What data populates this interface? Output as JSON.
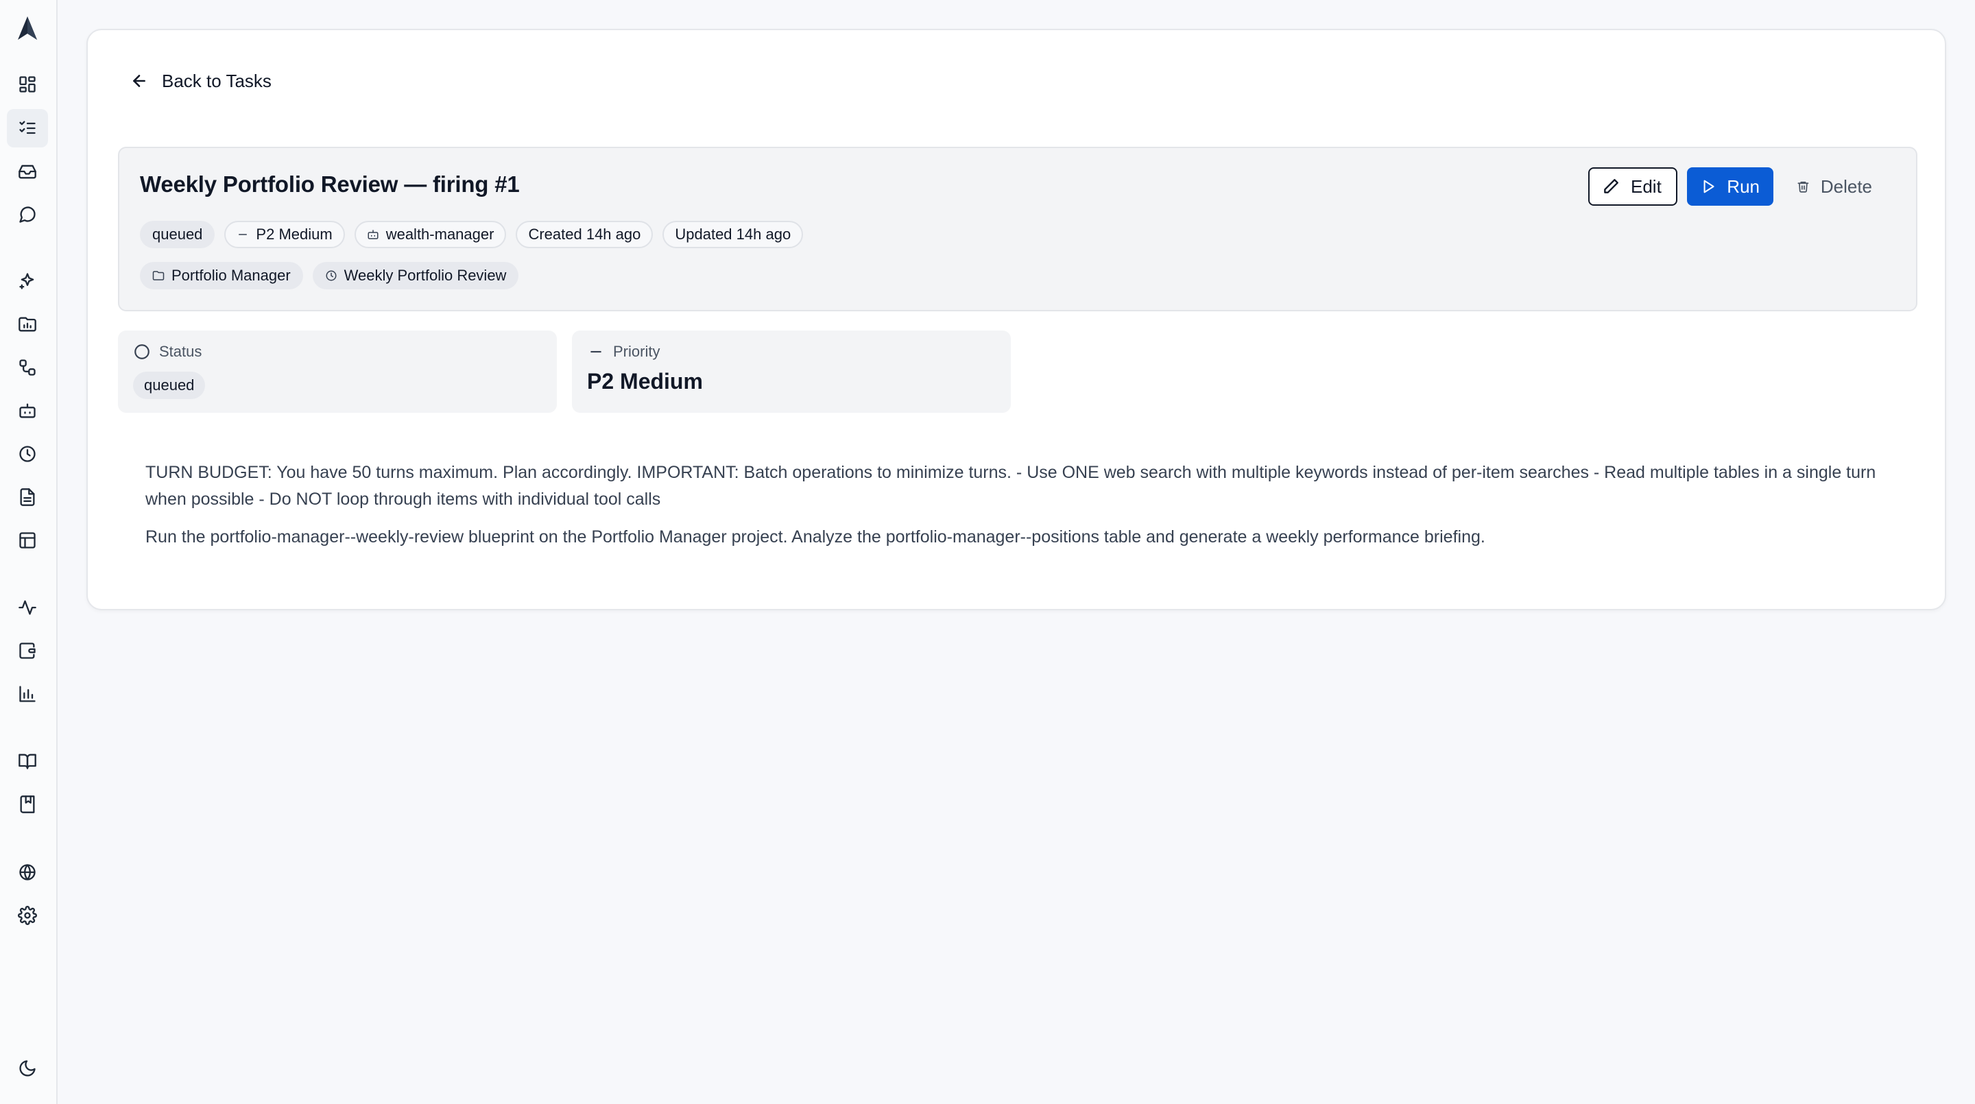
{
  "sidebar": {
    "items": [
      {
        "name": "dashboard",
        "icon": "dashboard-icon"
      },
      {
        "name": "tasks",
        "icon": "list-checks-icon",
        "active": true
      },
      {
        "name": "inbox",
        "icon": "inbox-icon"
      },
      {
        "name": "chat",
        "icon": "message-circle-icon"
      },
      {
        "name": "ai",
        "icon": "sparkles-icon"
      },
      {
        "name": "projects",
        "icon": "folder-chart-icon"
      },
      {
        "name": "workflows",
        "icon": "workflow-icon"
      },
      {
        "name": "agents",
        "icon": "bot-icon"
      },
      {
        "name": "schedules",
        "icon": "clock-icon"
      },
      {
        "name": "documents",
        "icon": "file-text-icon"
      },
      {
        "name": "tables",
        "icon": "table-icon"
      },
      {
        "name": "activity",
        "icon": "activity-icon"
      },
      {
        "name": "wallet",
        "icon": "wallet-icon"
      },
      {
        "name": "analytics",
        "icon": "bar-chart-icon"
      },
      {
        "name": "library",
        "icon": "book-open-icon"
      },
      {
        "name": "blueprints",
        "icon": "book-marked-icon"
      },
      {
        "name": "environments",
        "icon": "globe-icon"
      },
      {
        "name": "settings",
        "icon": "settings-icon"
      },
      {
        "name": "theme",
        "icon": "moon-icon"
      }
    ]
  },
  "back": {
    "label": "Back to Tasks"
  },
  "task": {
    "title": "Weekly Portfolio Review — firing #1",
    "chips": {
      "status": "queued",
      "priority": "P2 Medium",
      "agent": "wealth-manager",
      "created": "Created 14h ago",
      "updated": "Updated 14h ago",
      "project": "Portfolio Manager",
      "schedule": "Weekly Portfolio Review"
    }
  },
  "actions": {
    "edit": "Edit",
    "run": "Run",
    "delete": "Delete"
  },
  "status_card": {
    "label": "Status",
    "value": "queued"
  },
  "priority_card": {
    "label": "Priority",
    "value": "P2 Medium"
  },
  "description": {
    "p1": "TURN BUDGET: You have 50 turns maximum. Plan accordingly. IMPORTANT: Batch operations to minimize turns. - Use ONE web search with multiple keywords instead of per-item searches - Read multiple tables in a single turn when possible - Do NOT loop through items with individual tool calls",
    "p2": "Run the portfolio-manager--weekly-review blueprint on the Portfolio Manager project. Analyze the portfolio-manager--positions table and generate a weekly performance briefing."
  },
  "colors": {
    "accent": "#0b5cd5",
    "background": "#f7f8fb",
    "card": "#ffffff",
    "chip_bg": "#e7e9ee"
  }
}
